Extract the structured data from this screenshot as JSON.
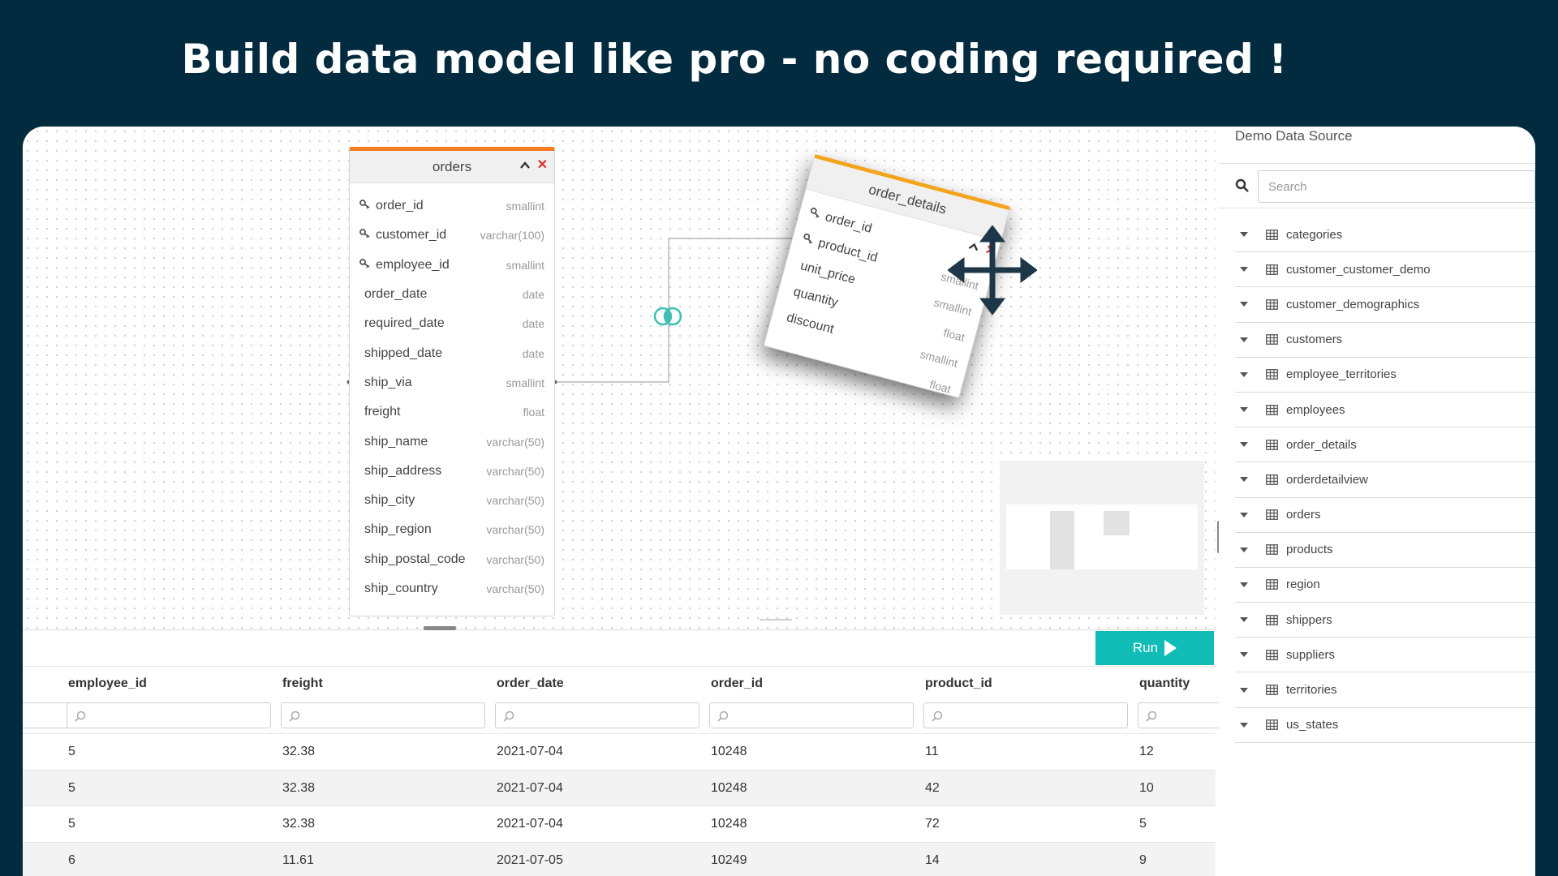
{
  "headline": "Build data model like pro - no coding required !",
  "orders_table": {
    "name": "orders",
    "fields": [
      {
        "name": "order_id",
        "type": "smallint",
        "key": true
      },
      {
        "name": "customer_id",
        "type": "varchar(100)",
        "key": true
      },
      {
        "name": "employee_id",
        "type": "smallint",
        "key": true
      },
      {
        "name": "order_date",
        "type": "date",
        "key": false
      },
      {
        "name": "required_date",
        "type": "date",
        "key": false
      },
      {
        "name": "shipped_date",
        "type": "date",
        "key": false
      },
      {
        "name": "ship_via",
        "type": "smallint",
        "key": false
      },
      {
        "name": "freight",
        "type": "float",
        "key": false
      },
      {
        "name": "ship_name",
        "type": "varchar(50)",
        "key": false
      },
      {
        "name": "ship_address",
        "type": "varchar(50)",
        "key": false
      },
      {
        "name": "ship_city",
        "type": "varchar(50)",
        "key": false
      },
      {
        "name": "ship_region",
        "type": "varchar(50)",
        "key": false
      },
      {
        "name": "ship_postal_code",
        "type": "varchar(50)",
        "key": false
      },
      {
        "name": "ship_country",
        "type": "varchar(50)",
        "key": false
      }
    ]
  },
  "order_details_table": {
    "name": "order_details",
    "fields": [
      {
        "name": "order_id",
        "type": "",
        "key": true
      },
      {
        "name": "product_id",
        "type": "smallint",
        "key": true
      },
      {
        "name": "unit_price",
        "type": "smallint",
        "key": false
      },
      {
        "name": "quantity",
        "type": "float",
        "key": false
      },
      {
        "name": "discount",
        "type": "smallint",
        "key": false
      },
      {
        "name": "",
        "type": "float",
        "key": false
      }
    ]
  },
  "toolbar": {
    "run_label": "Run"
  },
  "results": {
    "columns": [
      "employee_id",
      "freight",
      "order_date",
      "order_id",
      "product_id",
      "quantity"
    ],
    "rows": [
      [
        "5",
        "32.38",
        "2021-07-04",
        "10248",
        "11",
        "12"
      ],
      [
        "5",
        "32.38",
        "2021-07-04",
        "10248",
        "42",
        "10"
      ],
      [
        "5",
        "32.38",
        "2021-07-04",
        "10248",
        "72",
        "5"
      ],
      [
        "6",
        "11.61",
        "2021-07-05",
        "10249",
        "14",
        "9"
      ]
    ]
  },
  "sidebar": {
    "title": "Demo Data Source",
    "search_placeholder": "Search",
    "tables": [
      "categories",
      "customer_customer_demo",
      "customer_demographics",
      "customers",
      "employee_territories",
      "employees",
      "order_details",
      "orderdetailview",
      "orders",
      "products",
      "region",
      "shippers",
      "suppliers",
      "territories",
      "us_states"
    ]
  },
  "colors": {
    "background": "#032b3f",
    "orders_accent": "#f47b20",
    "order_details_accent": "#f3a41b",
    "run_button": "#11bcb6",
    "join_icon": "#3fbfb3",
    "close_icon": "#d9302a",
    "move_icon": "#1d3748"
  },
  "icons": {
    "key": "key-icon",
    "table": "table-grid-icon",
    "join": "join-venn-icon",
    "move": "move-arrows-icon",
    "search": "search-icon",
    "filter": "magnifier-icon",
    "collapse": "chevron-up-icon",
    "close": "close-icon",
    "expand": "caret-down-icon",
    "run": "play-icon"
  }
}
